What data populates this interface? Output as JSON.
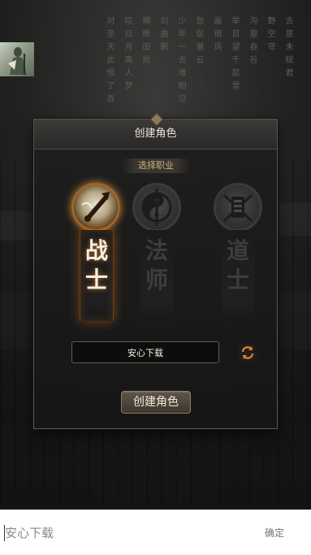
{
  "background": {
    "poem_columns": [
      "去意未赋君",
      "野空穹",
      "沟壑吞谷",
      "举目望千层雪",
      "画宿风",
      "愁促兼云",
      "少年一去难相见",
      "剑曲鹏",
      "横断田蛇",
      "叹日月离人梦",
      "对圣天此恨了吞"
    ]
  },
  "dialog": {
    "title": "创建角色",
    "subtitle": "选择职业",
    "classes": [
      {
        "name_line1": "战",
        "name_line2": "士",
        "icon": "warrior-emblem-icon",
        "selected": true
      },
      {
        "name_line1": "法",
        "name_line2": "师",
        "icon": "mage-emblem-icon",
        "selected": false
      },
      {
        "name_line1": "道",
        "name_line2": "士",
        "icon": "taoist-emblem-icon",
        "selected": false
      }
    ],
    "name_value": "安心下载",
    "refresh_icon": "refresh-icon",
    "create_button_label": "创建角色"
  },
  "input_bar": {
    "value": "安心下载",
    "confirm_label": "确定"
  },
  "colors": {
    "accent_gold": "#c7b279",
    "active_glow": "#d28a3a"
  }
}
